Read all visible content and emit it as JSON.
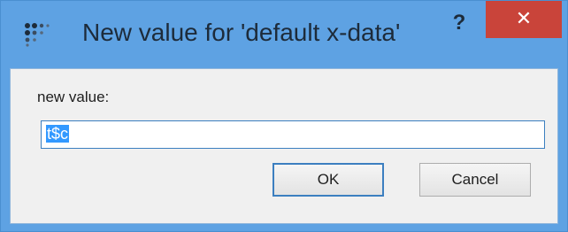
{
  "window": {
    "title": "New value for 'default x-data'",
    "help_label": "?",
    "close_label": "✕",
    "app_icon": "dots-grid-icon"
  },
  "form": {
    "label": "new value:",
    "value": "t$c"
  },
  "buttons": {
    "ok_label": "OK",
    "cancel_label": "Cancel"
  },
  "colors": {
    "titlebar": "#5ea2e3",
    "close_button": "#c9443a",
    "selection": "#3399ff"
  }
}
